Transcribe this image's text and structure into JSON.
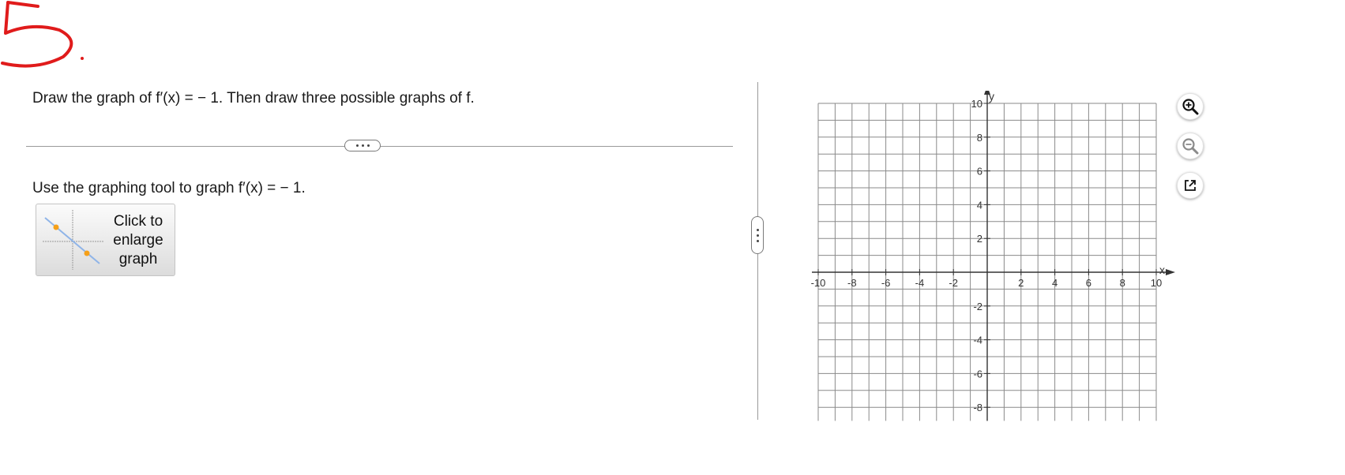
{
  "annotation": {
    "text": "5."
  },
  "question": {
    "prompt": "Draw the graph of f′(x) = − 1. Then draw three possible graphs of f.",
    "instruction": "Use the graphing tool to graph f′(x) = − 1."
  },
  "enlarge_button": {
    "label_line1": "Click to",
    "label_line2": "enlarge",
    "label_line3": "graph"
  },
  "graph": {
    "x_label": "x",
    "y_label": "y",
    "x_ticks": [
      -10,
      -8,
      -6,
      -4,
      -2,
      2,
      4,
      6,
      8,
      10
    ],
    "y_ticks": [
      10,
      8,
      6,
      4,
      2,
      -2,
      -4,
      -6,
      -8
    ],
    "x_range": [
      -10,
      10
    ],
    "y_range_visible": [
      -8,
      10
    ],
    "grid": true,
    "colors": {
      "grid": "#8a8a8a",
      "axis": "#333333"
    }
  },
  "tools": {
    "zoom_in_icon": "zoom-in-icon",
    "zoom_out_icon": "zoom-out-icon",
    "open_new_window_icon": "external-link-icon"
  },
  "colors": {
    "annotation": "#e01b1b",
    "thumbnail_point": "#f5a01a",
    "thumbnail_line": "#8fb4e8"
  }
}
